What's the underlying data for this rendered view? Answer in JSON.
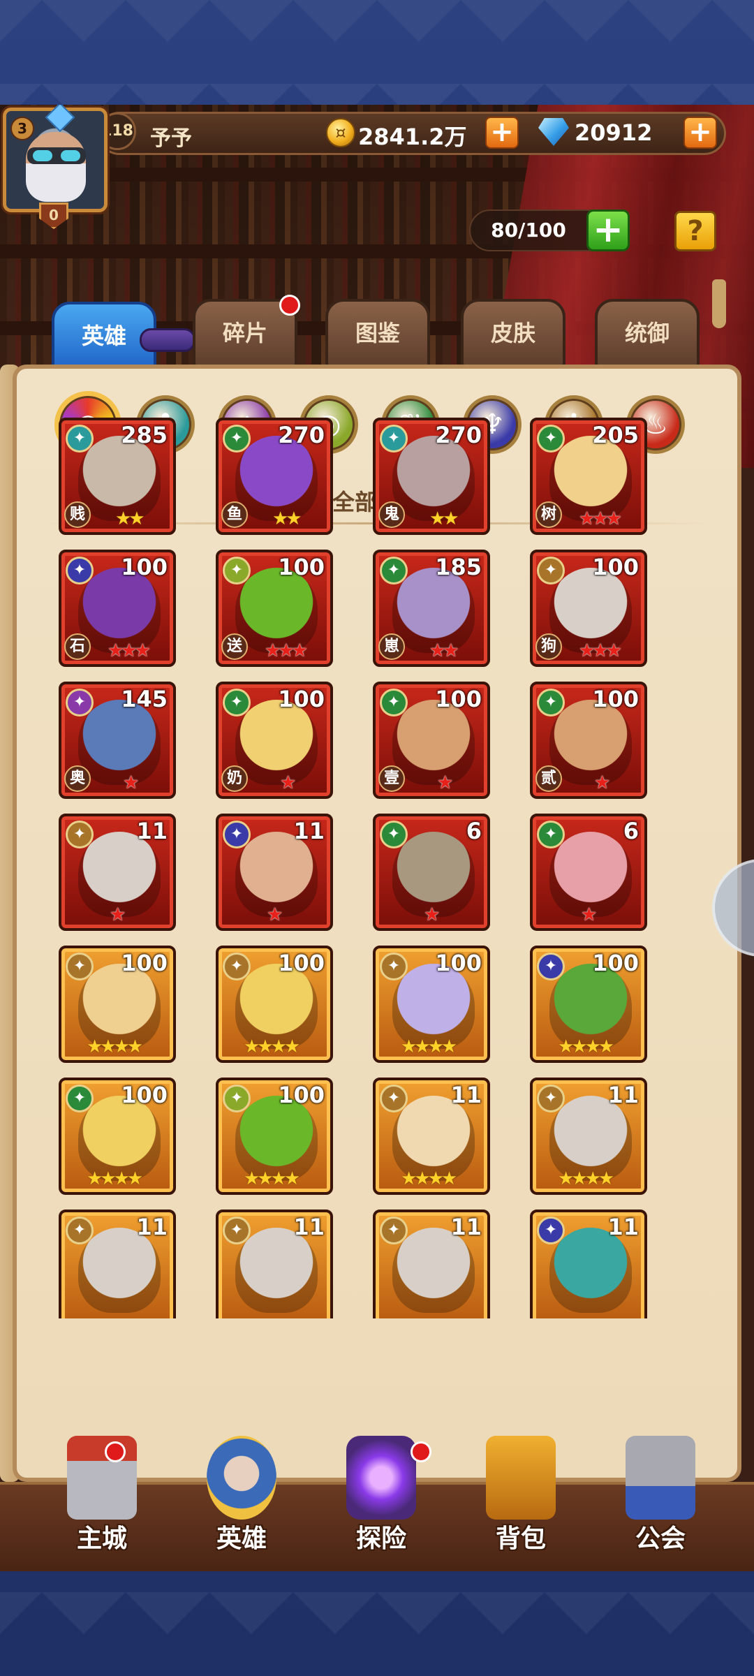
{
  "player": {
    "vip": "3",
    "shield": "0",
    "level": "118",
    "name": "予予"
  },
  "currency": {
    "coins": "2841.2万",
    "diamonds": "20912"
  },
  "stamina": "80/100",
  "help_label": "?",
  "tabs": [
    {
      "label": "英雄",
      "active": true
    },
    {
      "label": "碎片",
      "badge": true
    },
    {
      "label": "图鉴"
    },
    {
      "label": "皮肤"
    },
    {
      "label": "统御"
    }
  ],
  "race_filters": [
    {
      "name": "all",
      "glyph": "◉",
      "color": "#e85a3a"
    },
    {
      "name": "water",
      "glyph": "✤",
      "color": "#2a9a9a"
    },
    {
      "name": "shadow",
      "glyph": "◈",
      "color": "#8a3aa8"
    },
    {
      "name": "eye",
      "glyph": "◎",
      "color": "#8aa82a"
    },
    {
      "name": "nature",
      "glyph": "❦",
      "color": "#2a8a3a"
    },
    {
      "name": "demon",
      "glyph": "♆",
      "color": "#3a3aa8"
    },
    {
      "name": "holy",
      "glyph": "✻",
      "color": "#a8742a"
    },
    {
      "name": "fire",
      "glyph": "♨",
      "color": "#c82a1a"
    }
  ],
  "section_title": "全部种族",
  "heroes": [
    {
      "level": "285",
      "race": "贱",
      "frame": "red",
      "stars": "★★",
      "star_type": "gold",
      "faction_color": "#2a9a9a",
      "face": "#c9b9a8"
    },
    {
      "level": "270",
      "race": "鱼",
      "frame": "red",
      "stars": "★★",
      "star_type": "gold",
      "faction_color": "#2a8a3a",
      "face": "#8a4ac8"
    },
    {
      "level": "270",
      "race": "鬼",
      "frame": "red",
      "stars": "★★",
      "star_type": "gold",
      "faction_color": "#2a9a9a",
      "face": "#b8a0a0"
    },
    {
      "level": "205",
      "race": "树",
      "frame": "red",
      "stars": "★★★",
      "star_type": "red",
      "faction_color": "#2a8a3a",
      "face": "#f0d08a"
    },
    {
      "level": "100",
      "race": "石",
      "frame": "red",
      "stars": "★★★",
      "star_type": "red",
      "faction_color": "#3a3aa8",
      "face": "#7a3aa8"
    },
    {
      "level": "100",
      "race": "送",
      "frame": "red",
      "stars": "★★★",
      "star_type": "red",
      "faction_color": "#8aa82a",
      "face": "#6ab82a"
    },
    {
      "level": "185",
      "race": "崽",
      "frame": "red",
      "stars": "★★",
      "star_type": "red",
      "faction_color": "#2a8a3a",
      "face": "#a890c8"
    },
    {
      "level": "100",
      "race": "狗",
      "frame": "red",
      "stars": "★★★",
      "star_type": "red",
      "faction_color": "#a8742a",
      "face": "#d8d0c8"
    },
    {
      "level": "145",
      "race": "奥",
      "frame": "red",
      "stars": "★",
      "star_type": "red",
      "faction_color": "#8a3aa8",
      "face": "#5a7ab8"
    },
    {
      "level": "100",
      "race": "奶",
      "frame": "red",
      "stars": "★",
      "star_type": "red",
      "faction_color": "#2a8a3a",
      "face": "#f0d070"
    },
    {
      "level": "100",
      "race": "壹",
      "frame": "red",
      "stars": "★",
      "star_type": "red",
      "faction_color": "#2a8a3a",
      "face": "#d8a070"
    },
    {
      "level": "100",
      "race": "贰",
      "frame": "red",
      "stars": "★",
      "star_type": "red",
      "faction_color": "#2a8a3a",
      "face": "#d8a070"
    },
    {
      "level": "11",
      "race": "",
      "frame": "red",
      "stars": "★",
      "star_type": "red",
      "faction_color": "#a8742a",
      "face": "#d8d0c8"
    },
    {
      "level": "11",
      "race": "",
      "frame": "red",
      "stars": "★",
      "star_type": "red",
      "faction_color": "#3a3aa8",
      "face": "#e0b090"
    },
    {
      "level": "6",
      "race": "",
      "frame": "red",
      "stars": "★",
      "star_type": "red",
      "faction_color": "#2a8a3a",
      "face": "#a89880"
    },
    {
      "level": "6",
      "race": "",
      "frame": "red",
      "stars": "★",
      "star_type": "red",
      "faction_color": "#2a8a3a",
      "face": "#e8a0a8"
    },
    {
      "level": "100",
      "race": "",
      "frame": "orange",
      "stars": "★★★★",
      "star_type": "gold",
      "faction_color": "#a8742a",
      "face": "#f0d090"
    },
    {
      "level": "100",
      "race": "",
      "frame": "orange",
      "stars": "★★★★",
      "star_type": "gold",
      "faction_color": "#a8742a",
      "face": "#f0d060"
    },
    {
      "level": "100",
      "race": "",
      "frame": "orange",
      "stars": "★★★★",
      "star_type": "gold",
      "faction_color": "#a8742a",
      "face": "#c0b0e8"
    },
    {
      "level": "100",
      "race": "",
      "frame": "orange",
      "stars": "★★★★",
      "star_type": "gold",
      "faction_color": "#3a3aa8",
      "face": "#5aa83a"
    },
    {
      "level": "100",
      "race": "",
      "frame": "orange",
      "stars": "★★★★",
      "star_type": "gold",
      "faction_color": "#2a8a3a",
      "face": "#f0d060"
    },
    {
      "level": "100",
      "race": "",
      "frame": "orange",
      "stars": "★★★★",
      "star_type": "gold",
      "faction_color": "#8aa82a",
      "face": "#6ab82a"
    },
    {
      "level": "11",
      "race": "",
      "frame": "orange",
      "stars": "★★★★",
      "star_type": "gold",
      "faction_color": "#a8742a",
      "face": "#f0d8b0"
    },
    {
      "level": "11",
      "race": "",
      "frame": "orange",
      "stars": "★★★★",
      "star_type": "gold",
      "faction_color": "#a8742a",
      "face": "#d8d0c8"
    },
    {
      "level": "11",
      "race": "",
      "frame": "orange",
      "stars": "",
      "star_type": "gold",
      "faction_color": "#a8742a",
      "face": "#d8d0c8"
    },
    {
      "level": "11",
      "race": "",
      "frame": "orange",
      "stars": "",
      "star_type": "gold",
      "faction_color": "#a8742a",
      "face": "#d8d0c8"
    },
    {
      "level": "11",
      "race": "",
      "frame": "orange",
      "stars": "",
      "star_type": "gold",
      "faction_color": "#a8742a",
      "face": "#d8d0c8"
    },
    {
      "level": "11",
      "race": "",
      "frame": "orange",
      "stars": "",
      "star_type": "gold",
      "faction_color": "#3a3aa8",
      "face": "#3aa8a0"
    }
  ],
  "bottom_nav": [
    {
      "label": "主城",
      "icon": "castle-icon",
      "badge": true
    },
    {
      "label": "英雄",
      "icon": "hero-portrait-icon",
      "badge": false
    },
    {
      "label": "探险",
      "icon": "portal-icon",
      "badge": true
    },
    {
      "label": "背包",
      "icon": "backpack-icon",
      "badge": false
    },
    {
      "label": "公会",
      "icon": "guild-tower-icon",
      "badge": false
    }
  ]
}
